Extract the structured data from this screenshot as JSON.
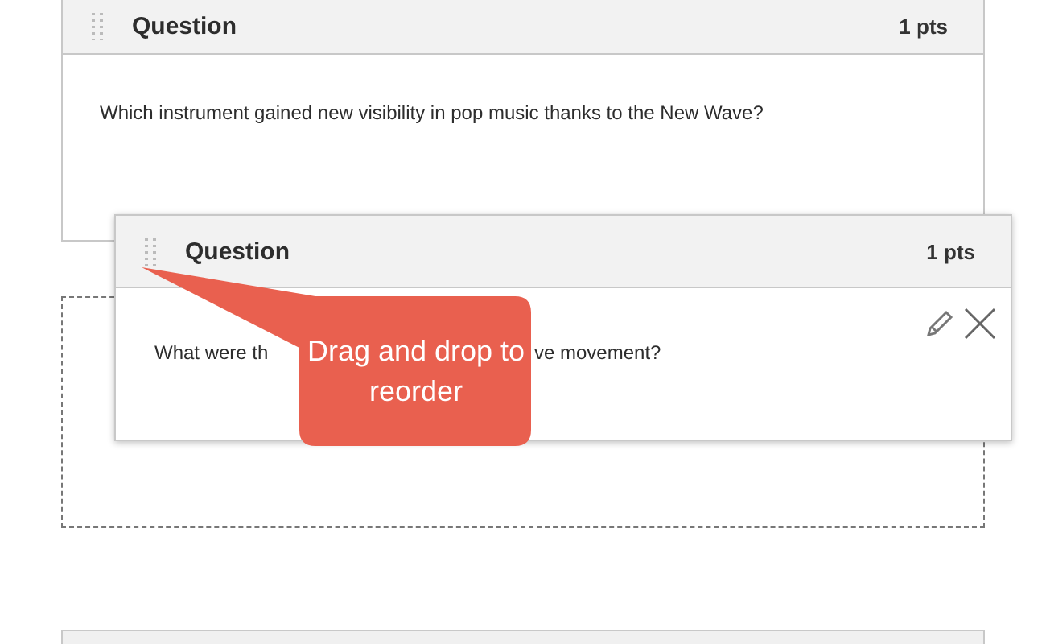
{
  "questions": [
    {
      "title": "Question",
      "points": "1 pts",
      "text": "Which instrument gained new visibility in pop music thanks to the New Wave?"
    }
  ],
  "dragged": {
    "title": "Question",
    "points": "1 pts",
    "text_before": "What were th",
    "text_after": "ve movement?"
  },
  "tooltip": {
    "text": "Drag and drop to reorder"
  }
}
